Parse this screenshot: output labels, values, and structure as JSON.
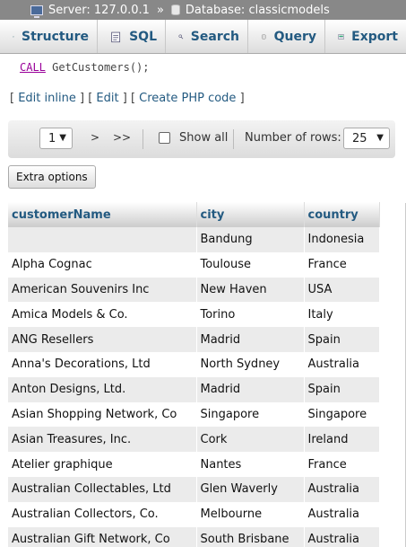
{
  "breadcrumb": {
    "server": "Server: 127.0.0.1",
    "separator": "»",
    "database": "Database: classicmodels"
  },
  "tabs": [
    {
      "label": "Structure",
      "icon": "structure-icon"
    },
    {
      "label": "SQL",
      "icon": "sql-icon"
    },
    {
      "label": "Search",
      "icon": "search-icon"
    },
    {
      "label": "Query",
      "icon": "query-icon"
    },
    {
      "label": "Export",
      "icon": "export-icon"
    }
  ],
  "query": {
    "keyword": "CALL",
    "rest": "GetCustomers();"
  },
  "links": {
    "open": "[",
    "edit_inline": "Edit inline",
    "mid1": "] [",
    "edit": "Edit",
    "mid2": "] [",
    "create_php": "Create PHP code",
    "close": "]"
  },
  "nav": {
    "page": "1",
    "next": ">",
    "last": ">>",
    "show_all": "Show all",
    "rows_label": "Number of rows:",
    "rows": "25"
  },
  "extra_options": "Extra options",
  "table": {
    "headers": [
      "customerName",
      "city",
      "country"
    ],
    "rows": [
      [
        "",
        "Bandung",
        "Indonesia"
      ],
      [
        "Alpha Cognac",
        "Toulouse",
        "France"
      ],
      [
        "American Souvenirs Inc",
        "New Haven",
        "USA"
      ],
      [
        "Amica Models & Co.",
        "Torino",
        "Italy"
      ],
      [
        "ANG Resellers",
        "Madrid",
        "Spain"
      ],
      [
        "Anna's Decorations, Ltd",
        "North Sydney",
        "Australia"
      ],
      [
        "Anton Designs, Ltd.",
        "Madrid",
        "Spain"
      ],
      [
        "Asian Shopping Network, Co",
        "Singapore",
        "Singapore"
      ],
      [
        "Asian Treasures, Inc.",
        "Cork",
        "Ireland"
      ],
      [
        "Atelier graphique",
        "Nantes",
        "France"
      ],
      [
        "Australian Collectables, Ltd",
        "Glen Waverly",
        "Australia"
      ],
      [
        "Australian Collectors, Co.",
        "Melbourne",
        "Australia"
      ],
      [
        "Australian Gift Network, Co",
        "South Brisbane",
        "Australia"
      ]
    ]
  },
  "colors": {
    "link": "#235a81",
    "keyword": "#990099"
  }
}
